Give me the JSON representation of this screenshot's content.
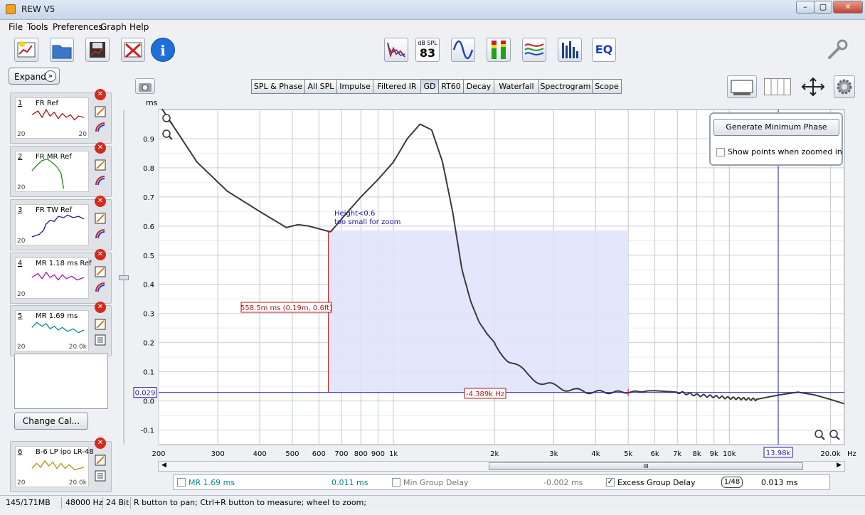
{
  "window": {
    "title": "REW V5",
    "min_label": "–",
    "max_label": "▢",
    "close_label": "✕"
  },
  "menu": [
    "File",
    "Tools",
    "Preferences",
    "Graph",
    "Help"
  ],
  "toolbar_left_icons": [
    "new-measurement-icon",
    "open-icon",
    "save-icon",
    "delete-measurement-icon",
    "info-icon"
  ],
  "toolbar_center_icons": [
    "spl-meter-icon",
    "spl-display-icon",
    "signal-generator-icon",
    "level-meter-icon",
    "rta-icon",
    "filters-icon",
    "eq-icon"
  ],
  "spl_value": "83",
  "spl_label": "dB SPL",
  "eq_label": "EQ",
  "graph_tabs": [
    "SPL & Phase",
    "All SPL",
    "Impulse",
    "Filtered IR",
    "GD",
    "RT60",
    "Decay",
    "Waterfall",
    "Spectrogram",
    "Scope"
  ],
  "selected_tab": "GD",
  "expand_label": "Expand",
  "expand_icon": "»",
  "measurements": [
    {
      "num": "1",
      "name": "FR Ref",
      "lo": "20",
      "hi": "20",
      "color": "#b01010"
    },
    {
      "num": "2",
      "name": "FR MR Ref",
      "lo": "20",
      "hi": "",
      "color": "#1a8a1a"
    },
    {
      "num": "3",
      "name": "FR TW Ref",
      "lo": "20",
      "hi": "",
      "color": "#1a1aa0"
    },
    {
      "num": "4",
      "name": "MR 1.18 ms Ref",
      "lo": "20",
      "hi": "",
      "color": "#b010b0"
    },
    {
      "num": "5",
      "name": "MR 1.69 ms",
      "lo": "20",
      "hi": "20.0k",
      "color": "#0a8a8a"
    },
    {
      "num": "6",
      "name": "B-6 LP ipo LR-48",
      "lo": "20",
      "hi": "20.0k",
      "color": "#b89010"
    }
  ],
  "change_cal_label": "Change Cal...",
  "plot": {
    "y_unit": "ms",
    "y_ticks": [
      "0.9",
      "0.8",
      "0.7",
      "0.6",
      "0.5",
      "0.4",
      "0.3",
      "0.2",
      "0.1",
      "0.0",
      "-0.1"
    ],
    "x_ticks": [
      "200",
      "300",
      "400",
      "500",
      "600",
      "700",
      "800",
      "900",
      "1k",
      "2k",
      "3k",
      "4k",
      "5k",
      "6k",
      "7k",
      "8k",
      "9k",
      "10k",
      "20.0k"
    ],
    "x_unit": "Hz",
    "height_msg_1": "Height<0.6",
    "height_msg_2": "too small for zoom",
    "marker_y": "0.029",
    "marker_x": "13.98k",
    "meas_label": "558.5m ms (0.19m, 0.6ft)",
    "delta_label": "-4.389k Hz"
  },
  "chart_data": {
    "type": "line",
    "x_scale": "log",
    "xlim": [
      200,
      22000
    ],
    "ylim": [
      -0.15,
      1.0
    ],
    "series": [
      {
        "name": "MR 1.69 ms",
        "x": [
          200,
          260,
          320,
          400,
          480,
          520,
          560,
          650,
          720,
          800,
          900,
          1000,
          1100,
          1200,
          1300,
          1400,
          1500,
          1600,
          1700,
          1800,
          1900,
          2000,
          2200,
          2500,
          2800,
          3000,
          3500,
          4000,
          4500,
          5000,
          6000,
          7000,
          8000,
          9000,
          10000,
          12000,
          14000,
          16000,
          18000,
          20000,
          22000
        ],
        "y": [
          1.02,
          0.82,
          0.72,
          0.65,
          0.595,
          0.605,
          0.6,
          0.58,
          0.64,
          0.7,
          0.76,
          0.82,
          0.9,
          0.95,
          0.93,
          0.82,
          0.65,
          0.45,
          0.34,
          0.27,
          0.23,
          0.2,
          0.14,
          0.09,
          0.06,
          0.05,
          0.035,
          0.03,
          0.03,
          0.03,
          0.035,
          0.03,
          0.02,
          0.015,
          0.01,
          0.005,
          0.02,
          0.03,
          0.02,
          0.005,
          -0.01
        ]
      }
    ]
  },
  "gen_min_phase_label": "Generate Minimum Phase",
  "show_points_label": "Show points when zoomed in",
  "legend": {
    "meas_name": "MR 1.69 ms",
    "meas_val": "0.011 ms",
    "min_gd_label": "Min Group Delay",
    "min_gd_val": "-0.002 ms",
    "excess_gd_label": "Excess Group Delay",
    "smooth_label": "1/48",
    "excess_val": "0.013 ms"
  },
  "status": {
    "mem": "145/171MB",
    "rate": "48000 Hz",
    "bits": "24 Bit",
    "hint": "R button to pan; Ctrl+R button to measure; wheel to zoom;"
  },
  "scroll_thumb": "III"
}
